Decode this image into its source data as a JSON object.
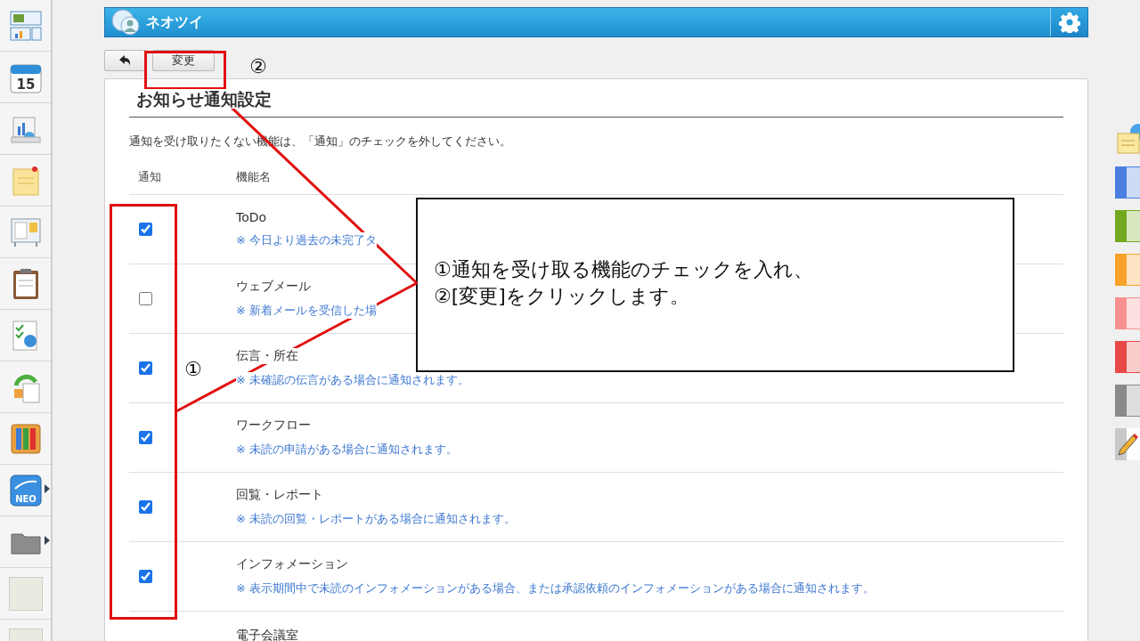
{
  "sidebar": [
    {
      "kind": "dashboard"
    },
    {
      "kind": "calendar",
      "label": "15"
    },
    {
      "kind": "chart"
    },
    {
      "kind": "memo"
    },
    {
      "kind": "board"
    },
    {
      "kind": "clipboard"
    },
    {
      "kind": "checklist"
    },
    {
      "kind": "cycle"
    },
    {
      "kind": "binders"
    },
    {
      "kind": "neo",
      "label": "NEO",
      "submenu": true
    },
    {
      "kind": "folder",
      "submenu": true
    },
    {
      "kind": "banner"
    },
    {
      "kind": "banner"
    }
  ],
  "header": {
    "title": "ネオツイ"
  },
  "toolbar": {
    "change_button": "変更"
  },
  "panel": {
    "title": "お知らせ通知設定",
    "instruction": "通知を受け取りたくない機能は、「通知」のチェックを外してください。",
    "columns": [
      "通知",
      "機能名"
    ]
  },
  "notifications": [
    {
      "name": "ToDo",
      "description": "※ 今日より過去の未完了タ",
      "checked": true
    },
    {
      "name": "ウェブメール",
      "description": "※ 新着メールを受信した場",
      "checked": false
    },
    {
      "name": "伝言・所在",
      "description": "※ 未確認の伝言がある場合に通知されます。",
      "checked": true
    },
    {
      "name": "ワークフロー",
      "description": "※ 未読の申請がある場合に通知されます。",
      "checked": true
    },
    {
      "name": "回覧・レポート",
      "description": "※ 未読の回覧・レポートがある場合に通知されます。",
      "checked": true
    },
    {
      "name": "インフォメーション",
      "description": "※ 表示期間中で未読のインフォメーションがある場合、または承認依頼のインフォメーションがある場合に通知されます。",
      "checked": true
    }
  ],
  "cut_row": {
    "name": "電子会議室"
  },
  "right_rail": {
    "tags": [
      {
        "color": "#4a7fe0"
      },
      {
        "color": "#72a81e"
      },
      {
        "color": "#f8a22a"
      },
      {
        "color": "#f99090"
      },
      {
        "color": "#e84848"
      },
      {
        "color": "#8a8a8a"
      }
    ]
  },
  "annotations": {
    "marker_1": "①",
    "marker_2": "②",
    "callout": [
      "①通知を受け取る機能のチェックを入れ、",
      "②[変更]をクリックします。"
    ]
  }
}
